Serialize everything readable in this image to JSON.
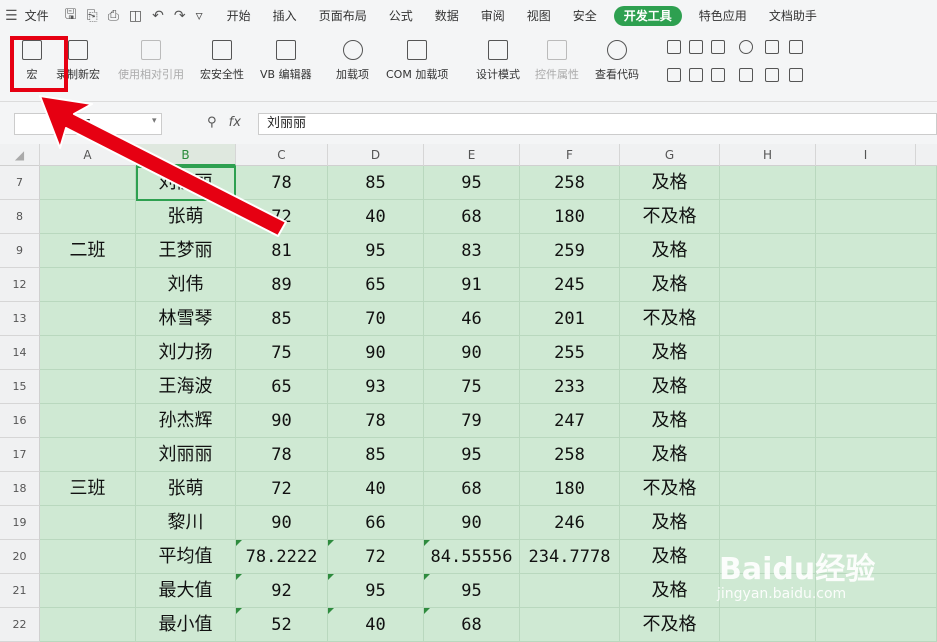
{
  "menubar": {
    "file_label": "文件",
    "tabs": [
      {
        "label": "开始"
      },
      {
        "label": "插入"
      },
      {
        "label": "页面布局"
      },
      {
        "label": "公式"
      },
      {
        "label": "数据"
      },
      {
        "label": "审阅"
      },
      {
        "label": "视图"
      },
      {
        "label": "安全"
      },
      {
        "label": "开发工具"
      },
      {
        "label": "特色应用"
      },
      {
        "label": "文档助手"
      }
    ]
  },
  "ribbon": {
    "macro": "宏",
    "record_macro": "录制新宏",
    "relative_ref": "使用相对引用",
    "macro_security": "宏安全性",
    "vb_editor": "VB 编辑器",
    "addins": "加载项",
    "com_addins": "COM 加载项",
    "design_mode": "设计模式",
    "control_props": "控件属性",
    "view_code": "查看代码"
  },
  "formula_bar": {
    "name_box": "B7",
    "fx": "fx",
    "value": "刘丽丽"
  },
  "columns": [
    "A",
    "B",
    "C",
    "D",
    "E",
    "F",
    "G",
    "H",
    "I"
  ],
  "rows": [
    {
      "num": "7",
      "A": "",
      "B": "刘丽丽",
      "C": "78",
      "D": "85",
      "E": "95",
      "F": "258",
      "G": "及格"
    },
    {
      "num": "8",
      "A": "",
      "B": "张萌",
      "C": "72",
      "D": "40",
      "E": "68",
      "F": "180",
      "G": "不及格"
    },
    {
      "num": "9",
      "A": "二班",
      "B": "王梦丽",
      "C": "81",
      "D": "95",
      "E": "83",
      "F": "259",
      "G": "及格"
    },
    {
      "num": "12",
      "A": "",
      "B": "刘伟",
      "C": "89",
      "D": "65",
      "E": "91",
      "F": "245",
      "G": "及格"
    },
    {
      "num": "13",
      "A": "",
      "B": "林雪琴",
      "C": "85",
      "D": "70",
      "E": "46",
      "F": "201",
      "G": "不及格"
    },
    {
      "num": "14",
      "A": "",
      "B": "刘力扬",
      "C": "75",
      "D": "90",
      "E": "90",
      "F": "255",
      "G": "及格"
    },
    {
      "num": "15",
      "A": "",
      "B": "王海波",
      "C": "65",
      "D": "93",
      "E": "75",
      "F": "233",
      "G": "及格"
    },
    {
      "num": "16",
      "A": "",
      "B": "孙杰辉",
      "C": "90",
      "D": "78",
      "E": "79",
      "F": "247",
      "G": "及格"
    },
    {
      "num": "17",
      "A": "",
      "B": "刘丽丽",
      "C": "78",
      "D": "85",
      "E": "95",
      "F": "258",
      "G": "及格"
    },
    {
      "num": "18",
      "A": "三班",
      "B": "张萌",
      "C": "72",
      "D": "40",
      "E": "68",
      "F": "180",
      "G": "不及格"
    },
    {
      "num": "19",
      "A": "",
      "B": "黎川",
      "C": "90",
      "D": "66",
      "E": "90",
      "F": "246",
      "G": "及格"
    },
    {
      "num": "20",
      "A": "",
      "B": "平均值",
      "C": "78.2222",
      "D": "72",
      "E": "84.55556",
      "F": "234.7778",
      "G": "及格"
    },
    {
      "num": "21",
      "A": "",
      "B": "最大值",
      "C": "92",
      "D": "95",
      "E": "95",
      "F": "",
      "G": "及格"
    },
    {
      "num": "22",
      "A": "",
      "B": "最小值",
      "C": "52",
      "D": "40",
      "E": "68",
      "F": "",
      "G": "不及格"
    }
  ],
  "watermark": {
    "brand": "Baidu经验",
    "url": "jingyan.baidu.com"
  },
  "colors": {
    "accent": "#2ea050",
    "cell_fill": "#cfe9d3",
    "highlight": "#e60012"
  }
}
